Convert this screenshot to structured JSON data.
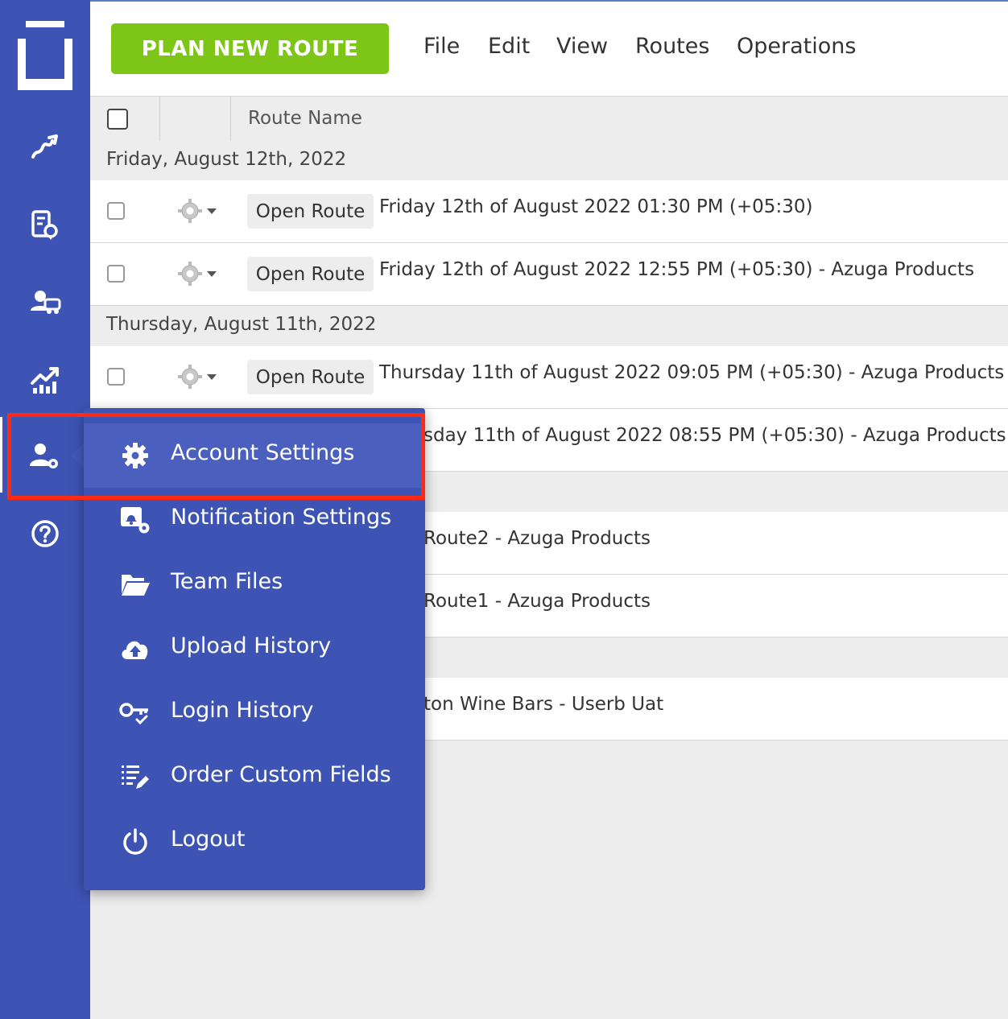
{
  "header": {
    "plan_button": "PLAN NEW ROUTE",
    "menus": [
      "File",
      "Edit",
      "View",
      "Routes",
      "Operations"
    ]
  },
  "table": {
    "column_route_name": "Route Name",
    "open_label": "Open Route",
    "groups": [
      "Friday, August 12th, 2022",
      "Thursday, August 11th, 2022"
    ],
    "rows": [
      "Friday 12th of August 2022 01:30 PM (+05:30)",
      "Friday 12th of August 2022 12:55 PM (+05:30) - Azuga Products",
      "Thursday 11th of August 2022 09:05 PM (+05:30) - Azuga Products",
      "sday 11th of August 2022 08:55 PM (+05:30) - Azuga Products",
      "Route2 - Azuga Products",
      "Route1 - Azuga Products",
      "ton Wine Bars - Userb Uat"
    ]
  },
  "dropdown": {
    "items": [
      {
        "label": "Account Settings",
        "icon": "gear-icon"
      },
      {
        "label": "Notification Settings",
        "icon": "notification-settings-icon"
      },
      {
        "label": "Team Files",
        "icon": "folder-open-icon"
      },
      {
        "label": "Upload History",
        "icon": "cloud-upload-icon"
      },
      {
        "label": "Login History",
        "icon": "key-check-icon"
      },
      {
        "label": "Order Custom Fields",
        "icon": "list-edit-icon"
      },
      {
        "label": "Logout",
        "icon": "power-icon"
      }
    ]
  },
  "colors": {
    "sidebar": "#3d54b4",
    "plan_button": "#7dc516",
    "highlight": "#ff2a14"
  }
}
